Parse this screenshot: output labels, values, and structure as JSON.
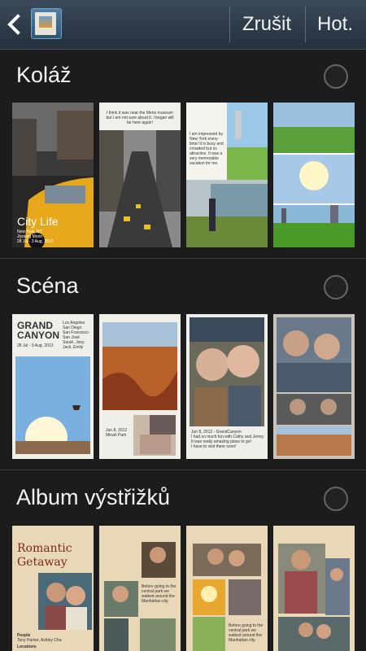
{
  "topbar": {
    "back_icon": "back-arrow-icon",
    "app_icon": "photo-album-icon",
    "cancel_label": "Zrušit",
    "done_label": "Hot."
  },
  "sections": [
    {
      "title": "Koláž",
      "tiles": [
        {
          "title": "City Life",
          "subtitle": [
            "New York, NY",
            "Jiyoung Moon",
            "28 Jul - 3 Aug, 2012"
          ]
        },
        {
          "caption": "I think it was near the Meno museum but I am not sure about it. I began will be here again!"
        },
        {
          "caption": "I am impressed by New York every time! It is busy and crowded but so attractive. It was a very memorable vacation for me."
        },
        {}
      ]
    },
    {
      "title": "Scéna",
      "tiles": [
        {
          "title": [
            "GRAND",
            "CANYON"
          ],
          "date": "28 Jul - 3 Aug, 2012",
          "people": [
            "Los Angeles",
            "San Diego",
            "San Francisco",
            "San José",
            "Sarah, Jony",
            "Jack, Emily"
          ]
        },
        {
          "caption": [
            "Jun 8, 2012",
            "Minah Park"
          ]
        },
        {
          "caption": [
            "Jun 8, 2012 - GrandCanyon",
            "I had so much fun with Cathy and Jenny.",
            "It was really amazing place to go!",
            "I have to visit there soon!"
          ]
        },
        {}
      ]
    },
    {
      "title": "Album výstřižků",
      "tiles": [
        {
          "title": [
            "Romantic",
            "Getaway"
          ],
          "people_label": "People",
          "people": "Tony Parker, Ashley Cha",
          "locations_label": "Locations"
        },
        {
          "caption": "Before going to the central park we walked around the Manhattan city."
        },
        {
          "caption": "Before going to the central park we walked around the Manhattan city."
        },
        {}
      ]
    }
  ]
}
